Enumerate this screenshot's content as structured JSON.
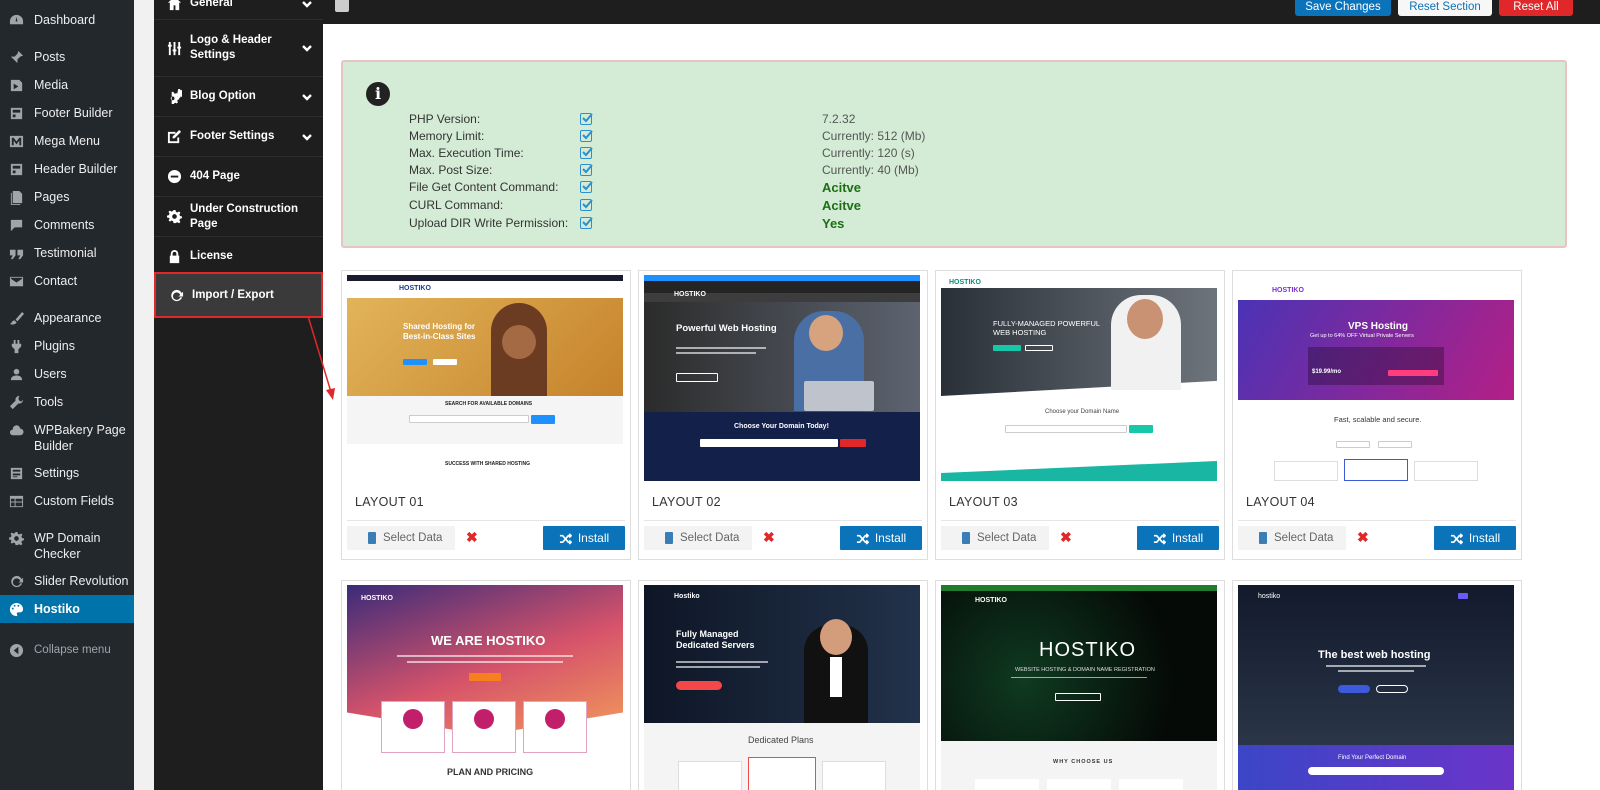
{
  "wp_menu": {
    "items": [
      {
        "label": "Dashboard",
        "icon": "dashboard-icon"
      },
      {
        "label": "Posts",
        "icon": "pin-icon"
      },
      {
        "label": "Media",
        "icon": "media-icon"
      },
      {
        "label": "Footer Builder",
        "icon": "builder-icon"
      },
      {
        "label": "Mega Menu",
        "icon": "mega-menu-icon"
      },
      {
        "label": "Header Builder",
        "icon": "builder-icon"
      },
      {
        "label": "Pages",
        "icon": "pages-icon"
      },
      {
        "label": "Comments",
        "icon": "comments-icon"
      },
      {
        "label": "Testimonial",
        "icon": "quote-icon"
      },
      {
        "label": "Contact",
        "icon": "mail-icon"
      },
      {
        "label": "Appearance",
        "icon": "brush-icon"
      },
      {
        "label": "Plugins",
        "icon": "plug-icon"
      },
      {
        "label": "Users",
        "icon": "users-icon"
      },
      {
        "label": "Tools",
        "icon": "wrench-icon"
      },
      {
        "label": "WPBakery Page Builder",
        "icon": "cloud-icon"
      },
      {
        "label": "Settings",
        "icon": "settings-icon"
      },
      {
        "label": "Custom Fields",
        "icon": "table-icon"
      },
      {
        "label": "WP Domain Checker",
        "icon": "gear-icon"
      },
      {
        "label": "Slider Revolution",
        "icon": "refresh-icon"
      },
      {
        "label": "Hostiko",
        "icon": "palette-icon",
        "active": true
      }
    ],
    "collapse_label": "Collapse menu"
  },
  "options_panel": {
    "items": [
      {
        "label": "General",
        "icon": "home-icon",
        "chevron": true
      },
      {
        "label": "Logo & Header Settings",
        "icon": "sliders-icon",
        "chevron": true
      },
      {
        "label": "Blog Option",
        "icon": "cogs-icon",
        "chevron": true
      },
      {
        "label": "Footer Settings",
        "icon": "edit-icon",
        "chevron": true
      },
      {
        "label": "404 Page",
        "icon": "minus-circle-icon",
        "chevron": false
      },
      {
        "label": "Under Construction Page",
        "icon": "gear-icon",
        "chevron": false
      },
      {
        "label": "License",
        "icon": "lock-icon",
        "chevron": false
      },
      {
        "label": "Import / Export",
        "icon": "refresh-icon",
        "chevron": false,
        "highlighted": true
      }
    ]
  },
  "toolbar": {
    "save_label": "Save Changes",
    "reset_section_label": "Reset Section",
    "reset_all_label": "Reset All"
  },
  "system_info": {
    "rows": [
      {
        "label": "PHP Version:",
        "value": "7.2.32",
        "emphasis": false
      },
      {
        "label": "Memory Limit:",
        "value": "Currently: 512 (Mb)",
        "emphasis": false
      },
      {
        "label": "Max. Execution Time:",
        "value": "Currently: 120 (s)",
        "emphasis": false
      },
      {
        "label": "Max. Post Size:",
        "value": "Currently: 40 (Mb)",
        "emphasis": false
      },
      {
        "label": "File Get Content Command:",
        "value": "Acitve",
        "emphasis": true
      },
      {
        "label": "CURL Command:",
        "value": "Acitve",
        "emphasis": true
      },
      {
        "label": "Upload DIR Write Permission:",
        "value": "Yes",
        "emphasis": true
      }
    ]
  },
  "layouts": {
    "select_label": "Select Data",
    "install_label": "Install",
    "delete_symbol": "✖",
    "cards": [
      {
        "title": "LAYOUT 01"
      },
      {
        "title": "LAYOUT 02"
      },
      {
        "title": "LAYOUT 03"
      },
      {
        "title": "LAYOUT 04"
      }
    ]
  },
  "thumbnails": {
    "l1": {
      "logo": "HOSTIKO",
      "headline": "Shared Hosting for Best-in-Class Sites",
      "search": "SEARCH FOR AVAILABLE DOMAINS",
      "footer": "SUCCESS WITH SHARED HOSTING"
    },
    "l2": {
      "logo": "HOSTIKO",
      "headline": "Powerful Web Hosting",
      "domain": "Choose Your Domain Today!"
    },
    "l3": {
      "logo": "HOSTIKO",
      "headline": "FULLY-MANAGED POWERFUL WEB HOSTING",
      "domain": "Choose your Domain Name"
    },
    "l4": {
      "logo": "HOSTIKO",
      "headline": "VPS Hosting",
      "sub": "Get up to 64% OFF Virtual Private Servers",
      "price": "$19.99/mo",
      "tagline": "Fast, scalable and secure."
    },
    "l5": {
      "logo": "HOSTIKO",
      "headline": "WE ARE HOSTIKO",
      "pricing": "PLAN AND PRICING"
    },
    "l6": {
      "logo": "Hostiko",
      "headline": "Fully Managed Dedicated Servers",
      "plans": "Dedicated Plans"
    },
    "l7": {
      "logo": "HOSTIKO",
      "headline": "HOSTIKO",
      "sub": "WEBSITE HOSTING & DOMAIN NAME REGISTRATION",
      "why": "WHY CHOOSE US"
    },
    "l8": {
      "logo": "hostiko",
      "headline": "The best web hosting",
      "domain": "Find Your Perfect Domain"
    }
  }
}
